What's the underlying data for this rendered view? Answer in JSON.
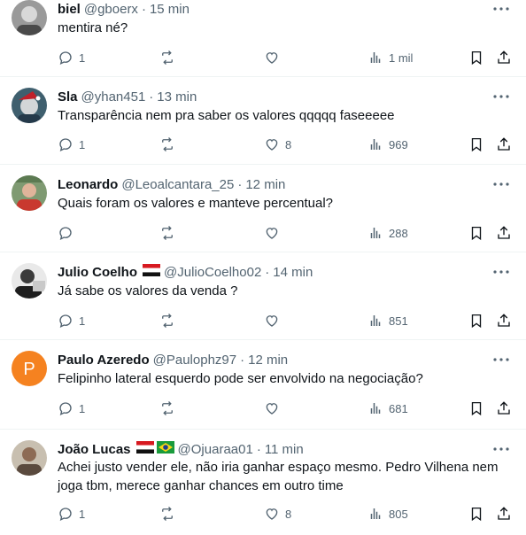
{
  "colors": {
    "text": "#0f1419",
    "muted": "#536471",
    "divider": "#eff3f4",
    "avatar_p": "#f58220"
  },
  "tweets": [
    {
      "name": "biel",
      "handle": "@gboerx",
      "time": "15 min",
      "text": "mentira né?",
      "replies": "1",
      "retweets": "",
      "likes": "",
      "views": "1 mil",
      "flags": []
    },
    {
      "name": "Sla",
      "handle": "@yhan451",
      "time": "13 min",
      "text": "Transparência nem pra saber os valores qqqqq faseeeee",
      "replies": "1",
      "retweets": "",
      "likes": "8",
      "views": "969",
      "flags": []
    },
    {
      "name": "Leonardo",
      "handle": "@Leoalcantara_25",
      "time": "12 min",
      "text": "Quais foram os valores e manteve percentual?",
      "replies": "",
      "retweets": "",
      "likes": "",
      "views": "288",
      "flags": []
    },
    {
      "name": "Julio Coelho",
      "handle": "@JulioCoelho02",
      "time": "14 min",
      "text": "Já sabe os valores da venda ?",
      "replies": "1",
      "retweets": "",
      "likes": "",
      "views": "851",
      "flags": [
        "sao-paulo-flag"
      ]
    },
    {
      "name": "Paulo Azeredo",
      "handle": "@Paulophz97",
      "time": "12 min",
      "text": "Felipinho lateral esquerdo pode ser envolvido na negociação?",
      "replies": "1",
      "retweets": "",
      "likes": "",
      "views": "681",
      "flags": [],
      "avatar_letter": "P"
    },
    {
      "name": "João Lucas",
      "handle": "@Ojuaraa01",
      "time": "11 min",
      "text": "Achei justo vender ele, não iria ganhar espaço mesmo. Pedro Vilhena nem joga tbm, merece ganhar chances em outro time",
      "replies": "1",
      "retweets": "",
      "likes": "8",
      "views": "805",
      "flags": [
        "sao-paulo-flag",
        "brazil-flag"
      ]
    }
  ]
}
